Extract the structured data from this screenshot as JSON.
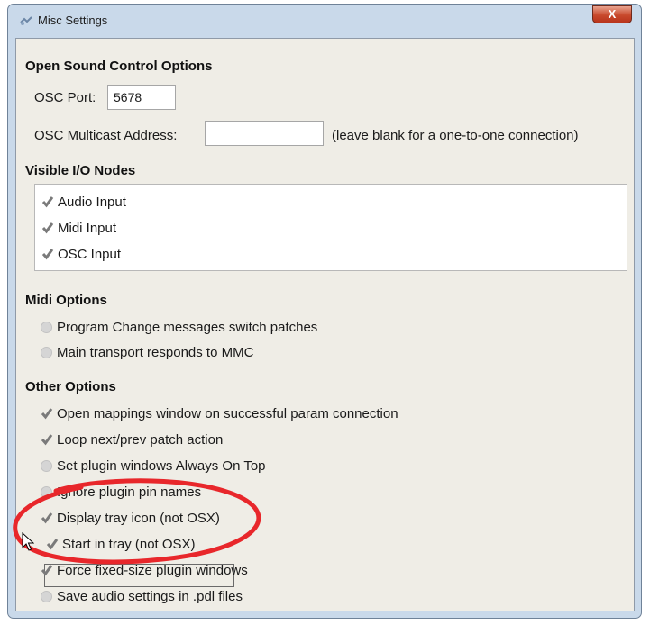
{
  "window": {
    "title": "Misc Settings",
    "close_label": "X"
  },
  "osc": {
    "section_title": "Open Sound Control Options",
    "port_label": "OSC Port:",
    "port_value": "5678",
    "multicast_label": "OSC Multicast Address:",
    "multicast_value": "",
    "multicast_hint": "(leave blank for a one-to-one connection)"
  },
  "io": {
    "section_title": "Visible I/O Nodes",
    "items": [
      {
        "label": "Audio Input",
        "checked": true
      },
      {
        "label": "Midi Input",
        "checked": true
      },
      {
        "label": "OSC Input",
        "checked": true
      }
    ]
  },
  "midi": {
    "section_title": "Midi Options",
    "items": [
      {
        "label": "Program Change messages switch patches",
        "checked": false
      },
      {
        "label": "Main transport responds to MMC",
        "checked": false
      }
    ]
  },
  "other": {
    "section_title": "Other Options",
    "items": [
      {
        "label": "Open mappings window on successful param connection",
        "checked": true
      },
      {
        "label": "Loop next/prev patch action",
        "checked": true
      },
      {
        "label": "Set plugin windows Always On Top",
        "checked": false
      },
      {
        "label": "Ignore plugin pin names",
        "checked": false
      },
      {
        "label": "Display tray icon (not OSX)",
        "checked": true
      },
      {
        "label": "Start in tray (not OSX)",
        "checked": true
      },
      {
        "label": "Force fixed-size plugin windows",
        "checked": true
      },
      {
        "label": "Save audio settings in .pdl files",
        "checked": false
      }
    ]
  },
  "colors": {
    "annotation": "#e8272b",
    "window_frame": "#c9d9ea",
    "client_bg": "#efede6"
  }
}
